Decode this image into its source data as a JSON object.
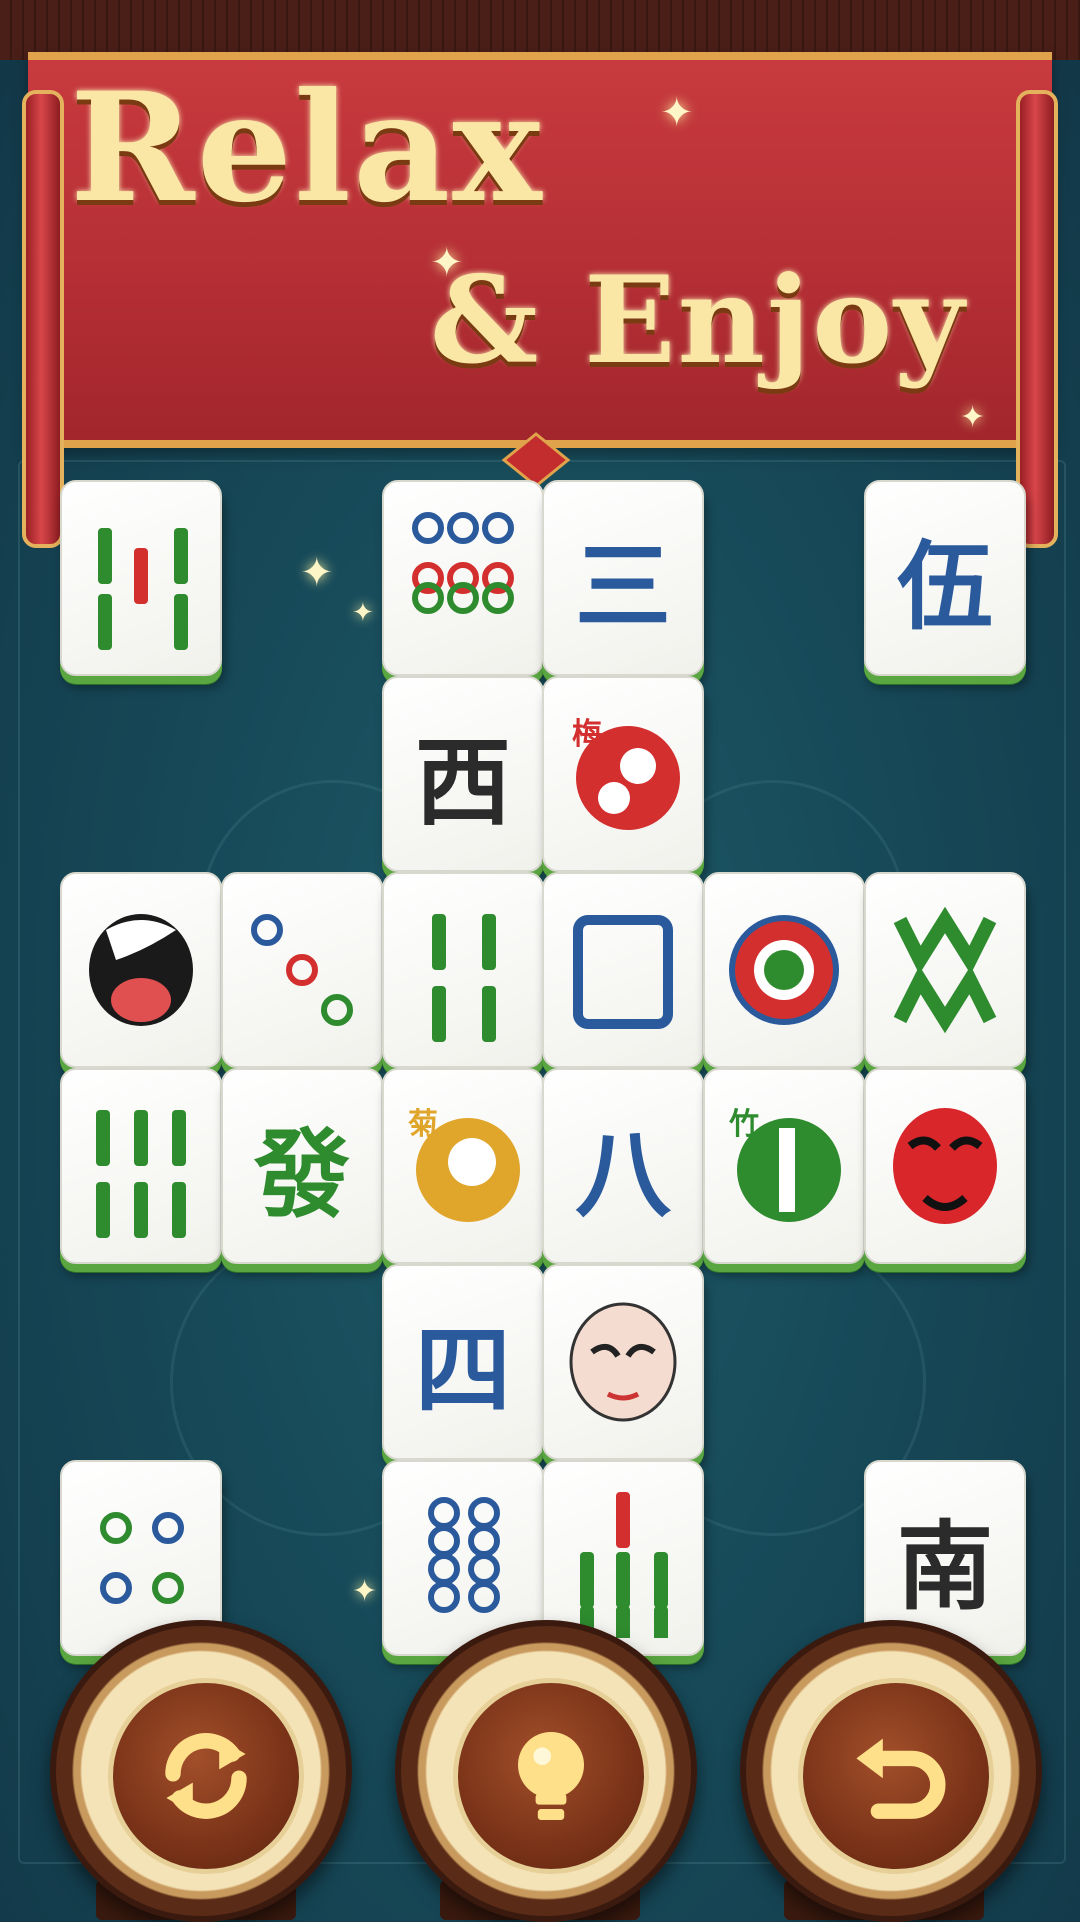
{
  "banner": {
    "line1": "Relax",
    "line2": "& Enjoy"
  },
  "tiles": [
    {
      "name": "tile-bamboo-3",
      "kind": "bamboo"
    },
    {
      "name": "tile-circles-9",
      "kind": "circles9"
    },
    {
      "name": "tile-san",
      "kind": "char",
      "glyph": "三",
      "color": "#2a5a9c"
    },
    {
      "name": "tile-wu",
      "kind": "char",
      "glyph": "伍",
      "color": "#2a5a9c"
    },
    {
      "name": "tile-west",
      "kind": "char",
      "glyph": "西",
      "color": "#2b2b2b"
    },
    {
      "name": "tile-plum",
      "kind": "plum",
      "glyph": "梅"
    },
    {
      "name": "tile-opera-mask-black",
      "kind": "mask-black"
    },
    {
      "name": "tile-circles-3",
      "kind": "circles3"
    },
    {
      "name": "tile-bamboo-4",
      "kind": "bamboo4"
    },
    {
      "name": "tile-white-dragon",
      "kind": "frame"
    },
    {
      "name": "tile-circle-1",
      "kind": "circle1"
    },
    {
      "name": "tile-bamboo-8",
      "kind": "bamboo8"
    },
    {
      "name": "tile-bamboo-6",
      "kind": "bamboo6"
    },
    {
      "name": "tile-green-dragon",
      "kind": "char",
      "glyph": "發",
      "color": "#2e8b2e"
    },
    {
      "name": "tile-chrysanthemum",
      "kind": "chrys",
      "glyph": "菊"
    },
    {
      "name": "tile-ba",
      "kind": "char",
      "glyph": "八",
      "color": "#2a5a9c"
    },
    {
      "name": "tile-bamboo-flower",
      "kind": "bamboo-flower",
      "glyph": "竹"
    },
    {
      "name": "tile-opera-mask-red",
      "kind": "mask-red"
    },
    {
      "name": "tile-si",
      "kind": "char",
      "glyph": "四",
      "color": "#2a5a9c"
    },
    {
      "name": "tile-opera-mask-white",
      "kind": "mask-white"
    },
    {
      "name": "tile-circles-4",
      "kind": "circles4"
    },
    {
      "name": "tile-circles-8",
      "kind": "circles8"
    },
    {
      "name": "tile-bamboo-7",
      "kind": "bamboo7"
    },
    {
      "name": "tile-south",
      "kind": "char",
      "glyph": "南",
      "color": "#2b2b2b"
    }
  ],
  "controls": [
    {
      "name": "shuffle-button",
      "icon": "shuffle-icon"
    },
    {
      "name": "hint-button",
      "icon": "lightbulb-icon"
    },
    {
      "name": "undo-button",
      "icon": "undo-icon"
    }
  ],
  "colors": {
    "banner": "#b52f35",
    "text": "#fbe7a5",
    "tile_edge": "#5aa641",
    "blue": "#2a5a9c",
    "green": "#2e8b2e",
    "red": "#d32f2f"
  }
}
